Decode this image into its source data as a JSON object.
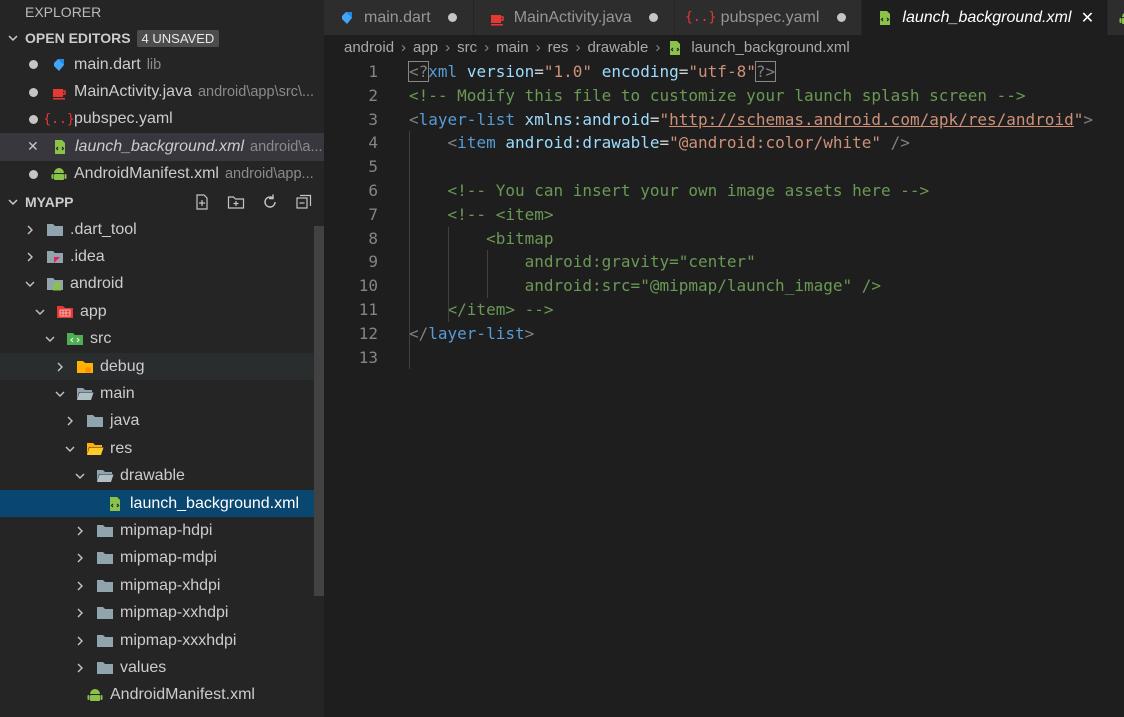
{
  "sidebar": {
    "title": "EXPLORER",
    "open_editors": {
      "label": "OPEN EDITORS",
      "badge": "4 UNSAVED",
      "items": [
        {
          "name": "main.dart",
          "desc": "lib"
        },
        {
          "name": "MainActivity.java",
          "desc": "android\\app\\src\\..."
        },
        {
          "name": "pubspec.yaml",
          "desc": ""
        },
        {
          "name": "launch_background.xml",
          "desc": "android\\a..."
        },
        {
          "name": "AndroidManifest.xml",
          "desc": "android\\app..."
        }
      ]
    },
    "project": {
      "label": "MYAPP",
      "tree": [
        {
          "name": ".dart_tool"
        },
        {
          "name": ".idea"
        },
        {
          "name": "android"
        },
        {
          "name": "app"
        },
        {
          "name": "src"
        },
        {
          "name": "debug"
        },
        {
          "name": "main"
        },
        {
          "name": "java"
        },
        {
          "name": "res"
        },
        {
          "name": "drawable"
        },
        {
          "name": "launch_background.xml"
        },
        {
          "name": "mipmap-hdpi"
        },
        {
          "name": "mipmap-mdpi"
        },
        {
          "name": "mipmap-xhdpi"
        },
        {
          "name": "mipmap-xxhdpi"
        },
        {
          "name": "mipmap-xxxhdpi"
        },
        {
          "name": "values"
        },
        {
          "name": "AndroidManifest.xml"
        }
      ]
    }
  },
  "tabs": [
    {
      "label": "main.dart"
    },
    {
      "label": "MainActivity.java"
    },
    {
      "label": "pubspec.yaml"
    },
    {
      "label": "launch_background.xml"
    }
  ],
  "breadcrumb": [
    "android",
    "app",
    "src",
    "main",
    "res",
    "drawable",
    "launch_background.xml"
  ],
  "code": {
    "line_numbers": [
      "1",
      "2",
      "3",
      "4",
      "5",
      "6",
      "7",
      "8",
      "9",
      "10",
      "11",
      "12",
      "13"
    ],
    "l1": {
      "open": "<?",
      "tag": "xml",
      "attr1": "version",
      "eq": "=",
      "val1": "\"1.0\"",
      "attr2": "encoding",
      "val2": "\"utf-8\"",
      "close": "?>"
    },
    "l2": "<!-- Modify this file to customize your launch splash screen -->",
    "l3": {
      "open": "<",
      "tag": "layer-list",
      "attr": "xmlns:android",
      "eq": "=",
      "q1": "\"",
      "url": "http://schemas.android.com/apk/res/android",
      "q2": "\"",
      "close": ">"
    },
    "l4": {
      "open": "<",
      "tag": "item",
      "attr": "android:drawable",
      "eq": "=",
      "val": "\"@android:color/white\"",
      "close": " />"
    },
    "l6": "<!-- You can insert your own image assets here -->",
    "l7": "<!-- <item>",
    "l8": "<bitmap",
    "l9": "android:gravity=\"center\"",
    "l10": "android:src=\"@mipmap/launch_image\" />",
    "l11": "</item> -->",
    "l12": {
      "open": "</",
      "tag": "layer-list",
      "close": ">"
    }
  },
  "colors": {
    "dart": "#42a5f5",
    "java": "#e53935",
    "yaml": "#e53935",
    "xml": "#8bc34a",
    "android": "#8bc34a",
    "folder": "#90a4ae",
    "active_row": "#094771"
  }
}
